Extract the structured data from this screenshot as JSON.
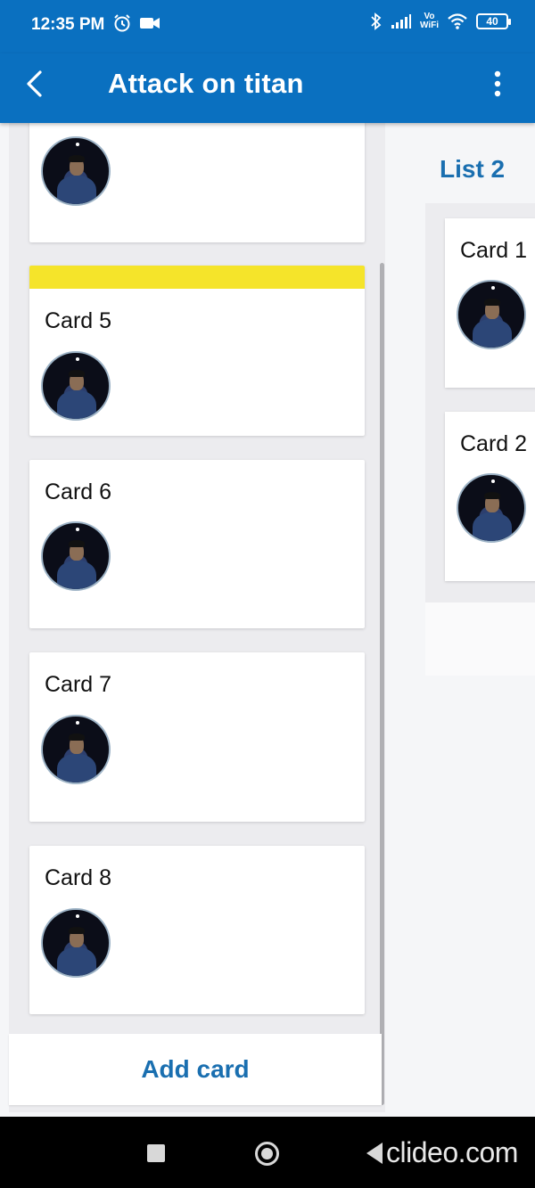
{
  "status_bar": {
    "time": "12:35 PM",
    "left_icons": [
      "alarm-icon",
      "video-camera-icon"
    ],
    "right_icons": [
      "bluetooth-icon",
      "signal-icon",
      "vowifi-icon",
      "wifi-icon",
      "battery-icon"
    ],
    "vowifi_top": "Vo",
    "vowifi_bottom": "WiFi",
    "battery": "40"
  },
  "app_bar": {
    "title": "Attack on titan",
    "back_icon": "back-arrow-icon",
    "menu_icon": "more-vertical-icon"
  },
  "colors": {
    "primary": "#0a70c0",
    "link": "#1a6fb0",
    "label_yellow": "#f5e42a",
    "list_bg": "#ececef"
  },
  "list1": {
    "cards": [
      {
        "title": "",
        "label_color": ""
      },
      {
        "title": "Card 5",
        "label_color": "#f5e42a"
      },
      {
        "title": "Card 6",
        "label_color": ""
      },
      {
        "title": "Card 7",
        "label_color": ""
      },
      {
        "title": "Card 8",
        "label_color": ""
      }
    ],
    "add_card_label": "Add card"
  },
  "list2": {
    "title": "List 2",
    "cards": [
      {
        "title": "Card 1"
      },
      {
        "title": "Card 2"
      }
    ]
  },
  "nav_bar": {
    "buttons": [
      "recents-icon",
      "home-icon",
      "back-icon"
    ],
    "watermark": "clideo.com"
  }
}
